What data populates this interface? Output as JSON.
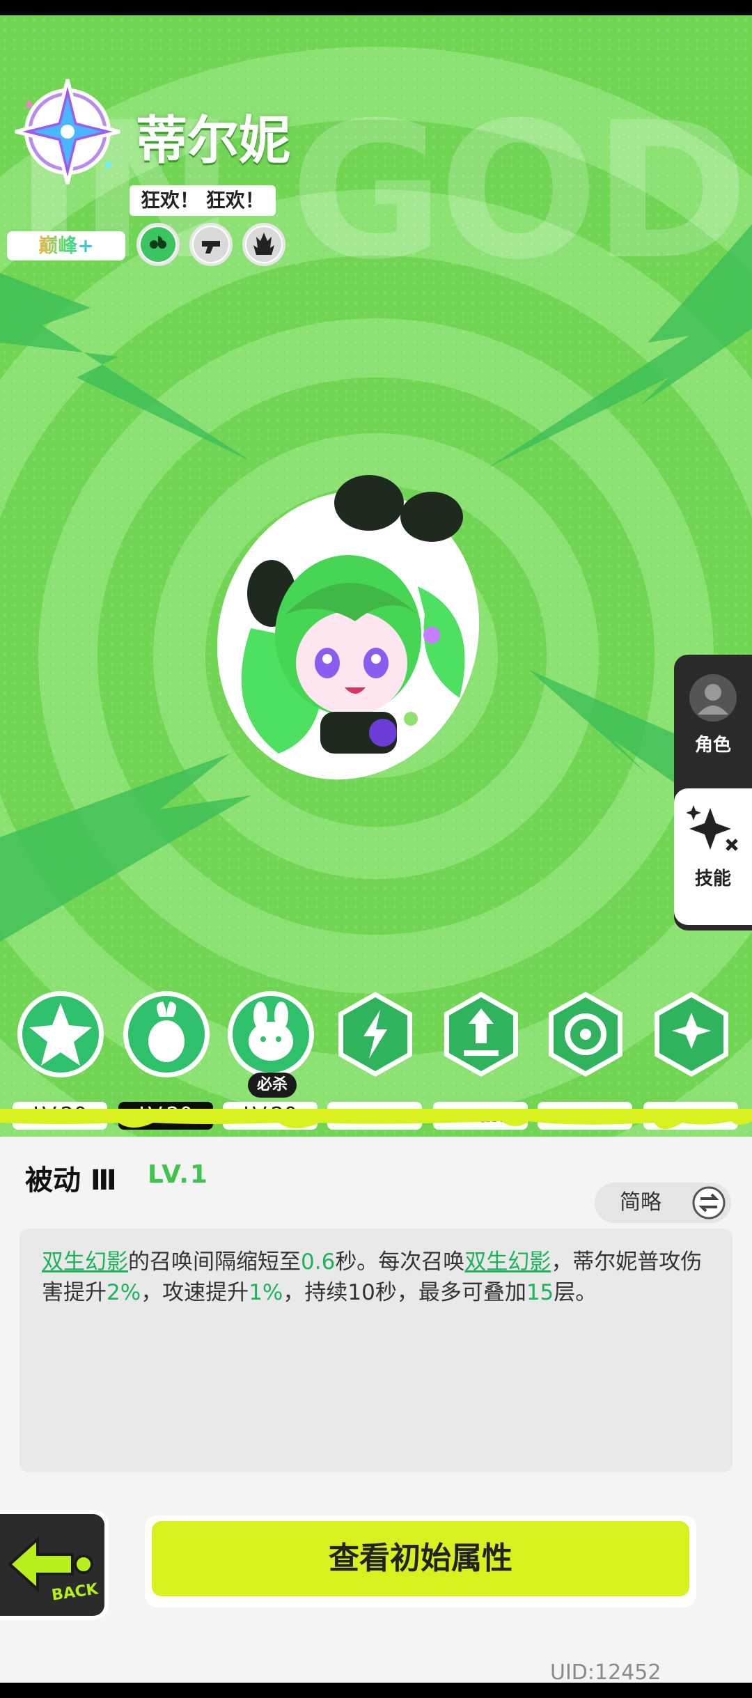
{
  "character": {
    "name": "蒂尔妮",
    "slogan": "狂欢！ 狂欢！",
    "rank": "巅峰+",
    "background_word": "IN GOD",
    "trait_icons": [
      "clover-icon",
      "gun-icon",
      "flame-icon"
    ]
  },
  "side_tabs": {
    "role": "角色",
    "skill": "技能"
  },
  "skills": [
    {
      "icon": "star-burst-icon",
      "level": "LV.20",
      "selected": false
    },
    {
      "icon": "radish-icon",
      "level": "LV.20",
      "selected": true
    },
    {
      "icon": "rabbit-icon",
      "level": "LV.20",
      "selected": false,
      "tag": "必杀"
    },
    {
      "icon": "lightning-icon",
      "level": "max",
      "selected": false
    },
    {
      "icon": "upgrade-arrow-icon",
      "level": "max",
      "selected": false
    },
    {
      "icon": "swirl-icon",
      "level": "max",
      "selected": false
    },
    {
      "icon": "spin-star-icon",
      "level": "max",
      "selected": false
    }
  ],
  "skill_detail": {
    "title": "被动 Ⅲ",
    "level": "LV.1",
    "toggle_label": "简略",
    "description": {
      "p1_link": "双生幻影",
      "p2": "的召唤间隔缩短至",
      "p3_val": "0.6",
      "p4": "秒。每次召唤",
      "p5_link": "双生幻影",
      "p6": "，蒂尔妮普攻伤害提升",
      "p7_val": "2%",
      "p8": "，攻速提升",
      "p9_val": "1%",
      "p10": "，持续10秒，最多可叠加",
      "p11_val": "15",
      "p12": "层。"
    }
  },
  "footer": {
    "back_label": "BACK",
    "cta_label": "查看初始属性",
    "uid": "UID:12452"
  },
  "colors": {
    "accent_green": "#1db35a",
    "cta_yellow": "#d8f01e",
    "max_purple": "#b534d8",
    "background_green": "#6fd553"
  }
}
